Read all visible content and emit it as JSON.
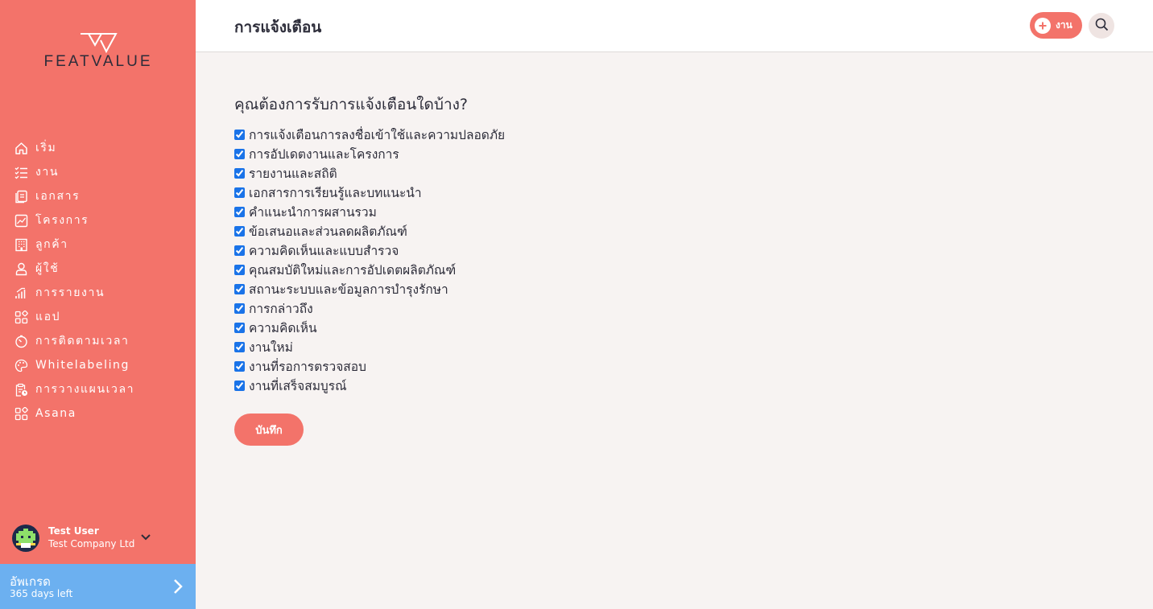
{
  "app": {
    "logo_text": "FEATVALUE",
    "accent_color": "#f3736a",
    "upgrade_color": "#6cb0f0"
  },
  "sidebar": {
    "items": [
      {
        "label": "เริ่ม",
        "icon": "home-icon"
      },
      {
        "label": "งาน",
        "icon": "task-list-icon"
      },
      {
        "label": "เอกสาร",
        "icon": "document-icon"
      },
      {
        "label": "โครงการ",
        "icon": "chart-icon"
      },
      {
        "label": "ลูกค้า",
        "icon": "building-icon"
      },
      {
        "label": "ผู้ใช้",
        "icon": "user-icon"
      },
      {
        "label": "การรายงาน",
        "icon": "bar-chart-icon"
      },
      {
        "label": "แอป",
        "icon": "apps-icon"
      },
      {
        "label": "การติดตามเวลา",
        "icon": "timer-icon"
      },
      {
        "label": "Whitelabeling",
        "icon": "palette-icon"
      },
      {
        "label": "การวางแผนเวลา",
        "icon": "clipboard-clock-icon"
      },
      {
        "label": "Asana",
        "icon": "apps-icon"
      }
    ],
    "user": {
      "name": "Test User",
      "company": "Test Company Ltd"
    },
    "upgrade": {
      "title": "อัพเกรด",
      "subtitle": "365 days left"
    }
  },
  "header": {
    "title": "การแจ้งเตือน",
    "add_task_label": "งาน"
  },
  "main": {
    "question": "คุณต้องการรับการแจ้งเตือนใดบ้าง?",
    "options": [
      {
        "label": "การแจ้งเตือนการลงชื่อเข้าใช้และความปลอดภัย",
        "checked": true
      },
      {
        "label": "การอัปเดตงานและโครงการ",
        "checked": true
      },
      {
        "label": "รายงานและสถิติ",
        "checked": true
      },
      {
        "label": "เอกสารการเรียนรู้และบทแนะนำ",
        "checked": true
      },
      {
        "label": "คำแนะนำการผสานรวม",
        "checked": true
      },
      {
        "label": "ข้อเสนอและส่วนลดผลิตภัณฑ์",
        "checked": true
      },
      {
        "label": "ความคิดเห็นและแบบสำรวจ",
        "checked": true
      },
      {
        "label": "คุณสมบัติใหม่และการอัปเดตผลิตภัณฑ์",
        "checked": true
      },
      {
        "label": "สถานะระบบและข้อมูลการบำรุงรักษา",
        "checked": true
      },
      {
        "label": "การกล่าวถึง",
        "checked": true
      },
      {
        "label": "ความคิดเห็น",
        "checked": true
      },
      {
        "label": "งานใหม่",
        "checked": true
      },
      {
        "label": "งานที่รอการตรวจสอบ",
        "checked": true
      },
      {
        "label": "งานที่เสร็จสมบูรณ์",
        "checked": true
      }
    ],
    "save_label": "บันทึก"
  }
}
